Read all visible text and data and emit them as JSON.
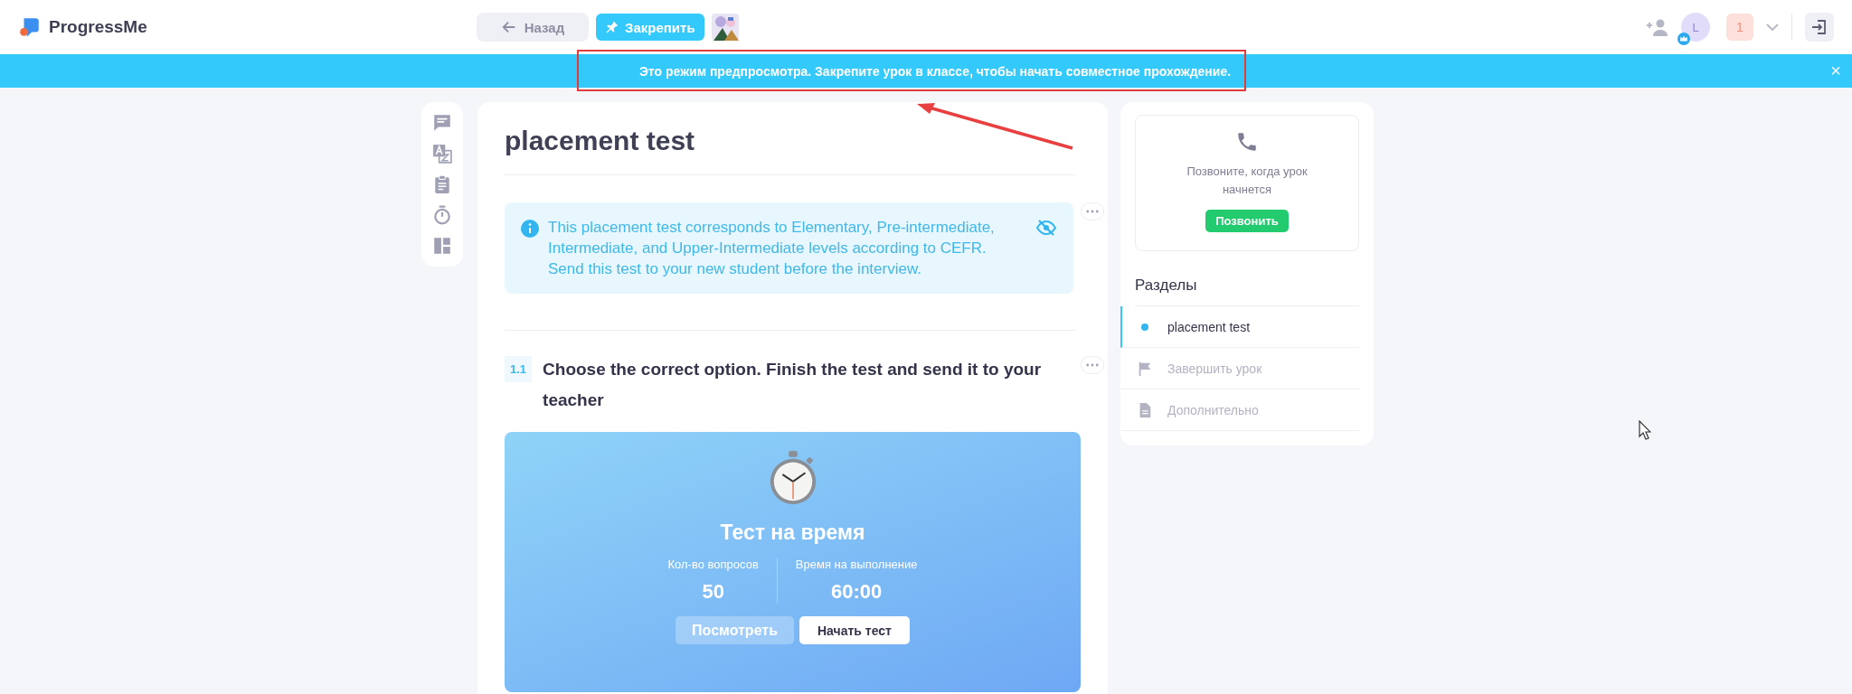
{
  "header": {
    "logo": "ProgressMe",
    "back_button": "Назад",
    "pin_button": "Закрепить",
    "avatar_letter": "L",
    "notification_count": "1"
  },
  "banner": {
    "text": "Это режим предпросмотра. Закрепите урок в классе, чтобы начать совместное прохождение.",
    "close": "×"
  },
  "tools": [
    {
      "kind": "chat"
    },
    {
      "kind": "translate"
    },
    {
      "kind": "clipboard"
    },
    {
      "kind": "timer"
    },
    {
      "kind": "layout"
    }
  ],
  "lesson": {
    "title": "placement test",
    "info": "This placement test corresponds to Elementary, Pre-intermediate, Intermediate, and Upper-Intermediate levels according to CEFR. Send this test to your new student before the interview.",
    "exercise": {
      "number": "1.1",
      "title": "Choose the correct option. Finish the test and send it to your teacher"
    },
    "timed_test": {
      "title": "Тест на время",
      "stats": [
        {
          "label": "Кол-во вопросов",
          "value": "50"
        },
        {
          "label": "Время на выполнение",
          "value": "60:00"
        }
      ],
      "view_button": "Посмотреть",
      "start_button": "Начать тест"
    }
  },
  "call": {
    "text": "Позвоните, когда урок начнется",
    "button": "Позвонить"
  },
  "sections": {
    "title": "Разделы",
    "items": [
      {
        "kind": "dot",
        "label": "placement test",
        "selected": true
      },
      {
        "kind": "flag",
        "label": "Завершить урок",
        "selected": false
      },
      {
        "kind": "doc",
        "label": "Дополнительно",
        "selected": false
      }
    ]
  }
}
